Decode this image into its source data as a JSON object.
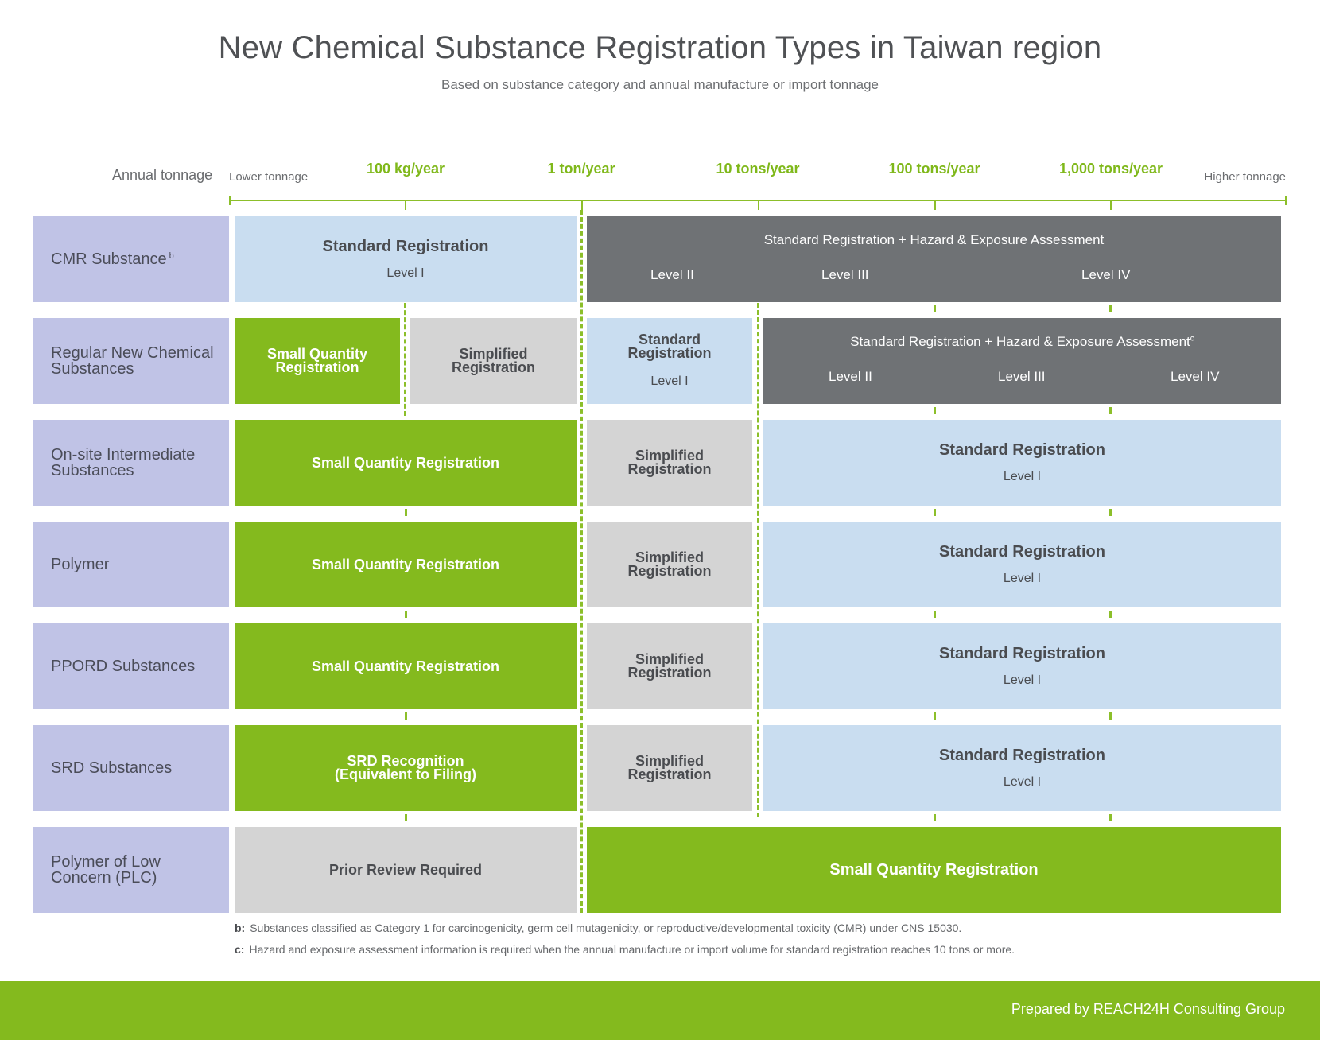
{
  "header": {
    "title": "New Chemical Substance Registration Types in Taiwan region",
    "subtitle": "Based on substance category and annual manufacture or import tonnage"
  },
  "axis": {
    "label": "Annual tonnage",
    "lower": "Lower tonnage",
    "higher": "Higher tonnage",
    "ticks": [
      "100 kg/year",
      "1 ton/year",
      "10 tons/year",
      "100 tons/year",
      "1,000 tons/year"
    ]
  },
  "rows": {
    "cmr": {
      "label": "CMR Substance",
      "sup": "b",
      "standard_title": "Standard Registration",
      "standard_level": "Level I",
      "assess_title": "Standard Registration + Hazard & Exposure Assessment",
      "level2": "Level II",
      "level3": "Level III",
      "level4": "Level IV"
    },
    "regular": {
      "label_line1": "Regular New Chemical",
      "label_line2": "Substances",
      "small_line1": "Small Quantity",
      "small_line2": "Registration",
      "simplified_line1": "Simplified",
      "simplified_line2": "Registration",
      "standard_line1": "Standard",
      "standard_line2": "Registration",
      "standard_level": "Level I",
      "assess_title": "Standard Registration + Hazard & Exposure Assessment",
      "assess_sup": "c",
      "level2": "Level II",
      "level3": "Level III",
      "level4": "Level IV"
    },
    "onsite": {
      "label_line1": "On-site Intermediate",
      "label_line2": "Substances",
      "small": "Small Quantity Registration",
      "simplified_line1": "Simplified",
      "simplified_line2": "Registration",
      "standard_title": "Standard Registration",
      "standard_level": "Level I"
    },
    "polymer": {
      "label": "Polymer",
      "small": "Small Quantity Registration",
      "simplified_line1": "Simplified",
      "simplified_line2": "Registration",
      "standard_title": "Standard Registration",
      "standard_level": "Level I"
    },
    "ppord": {
      "label": "PPORD Substances",
      "small": "Small Quantity Registration",
      "simplified_line1": "Simplified",
      "simplified_line2": "Registration",
      "standard_title": "Standard Registration",
      "standard_level": "Level I"
    },
    "srd": {
      "label": "SRD Substances",
      "srd_line1": "SRD Recognition",
      "srd_line2": "(Equivalent to Filing)",
      "simplified_line1": "Simplified",
      "simplified_line2": "Registration",
      "standard_title": "Standard Registration",
      "standard_level": "Level I"
    },
    "plc": {
      "label_line1": "Polymer of Low",
      "label_line2": "Concern (PLC)",
      "prior": "Prior Review Required",
      "small": "Small Quantity Registration"
    }
  },
  "notes": {
    "b_key": "b:",
    "b_text": "Substances classified as Category 1 for carcinogenicity, germ cell mutagenicity, or reproductive/developmental toxicity (CMR) under CNS 15030.",
    "c_key": "c:",
    "c_text": "Hazard and exposure assessment information is required when the annual manufacture or import volume for standard registration reaches 10 tons or more."
  },
  "footer": {
    "text": "Prepared by REACH24H Consulting Group"
  },
  "colors": {
    "green": "#84ba1e",
    "light_blue": "#c9ddf0",
    "gray": "#d4d4d4",
    "dark_gray": "#6f7275",
    "lavender": "#c0c3e6"
  }
}
